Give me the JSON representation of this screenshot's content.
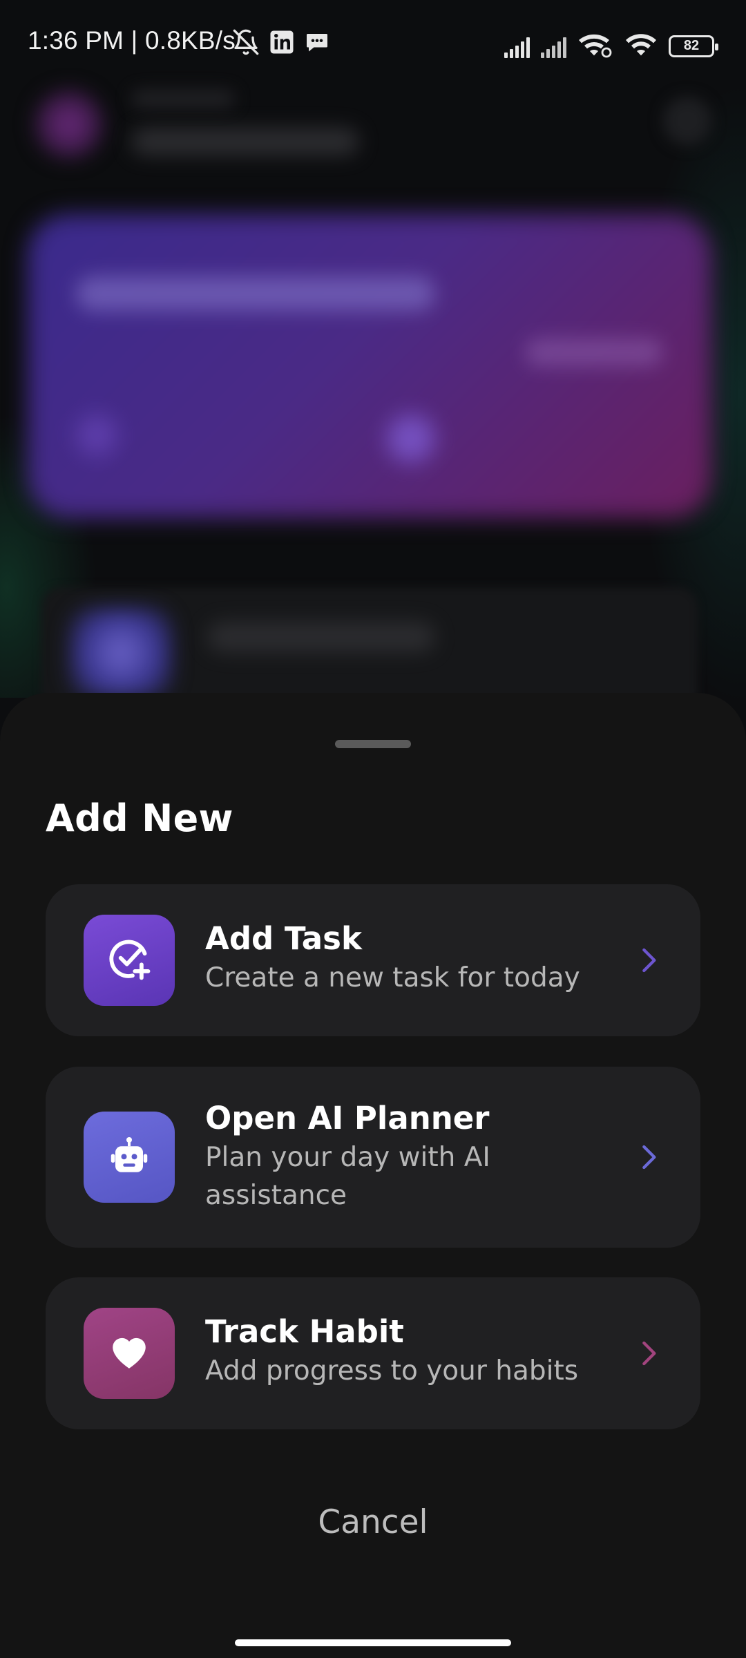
{
  "status_bar": {
    "time_speed": "1:36 PM | 0.8KB/s",
    "battery_level": "82",
    "left_icons": [
      "bell-off-icon",
      "linkedin-icon",
      "message-icon"
    ],
    "right_icons": [
      "signal-icon",
      "signal-icon",
      "wifi-link-icon",
      "wifi-icon",
      "battery-icon"
    ]
  },
  "sheet": {
    "title": "Add New",
    "options": [
      {
        "title": "Add Task",
        "subtitle": "Create a new task for today",
        "icon": "check-plus-icon",
        "accent": "#6a3fc8",
        "chevron_color": "#6d55d0"
      },
      {
        "title": "Open AI Planner",
        "subtitle": "Plan your day with AI assistance",
        "icon": "robot-icon",
        "accent": "#6262d2",
        "chevron_color": "#6b6ad8"
      },
      {
        "title": "Track Habit",
        "subtitle": "Add progress to your habits",
        "icon": "heart-icon",
        "accent": "#943d78",
        "chevron_color": "#a2447e"
      }
    ],
    "cancel_label": "Cancel"
  }
}
